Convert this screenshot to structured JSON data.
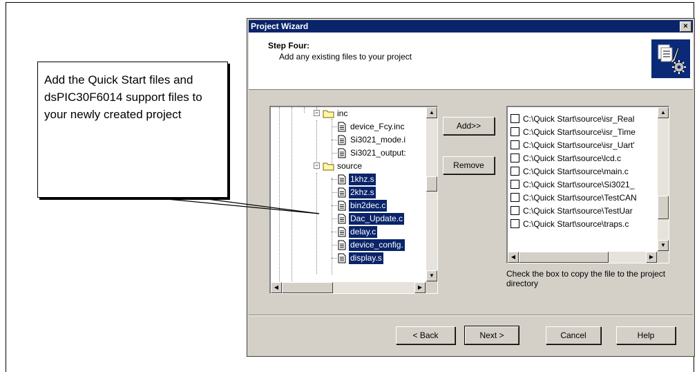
{
  "callout": {
    "text": "Add the Quick Start files and dsPIC30F6014 support files to your newly created project"
  },
  "dialog": {
    "title": "Project Wizard",
    "close_glyph": "×",
    "step_title": "Step Four:",
    "step_subtitle": "Add any existing files to your project",
    "header_icon": "wizard-tools-icon"
  },
  "tree": {
    "items": [
      {
        "label": "inc",
        "type": "folder",
        "expanded": true,
        "selected": false
      },
      {
        "label": "device_Fcy.inc",
        "type": "file",
        "selected": false
      },
      {
        "label": "Si3021_mode.i",
        "type": "file",
        "selected": false
      },
      {
        "label": "Si3021_output:",
        "type": "file",
        "selected": false
      },
      {
        "label": "source",
        "type": "folder",
        "expanded": true,
        "selected": false
      },
      {
        "label": "1khz.s",
        "type": "file",
        "selected": true
      },
      {
        "label": "2khz.s",
        "type": "file",
        "selected": true
      },
      {
        "label": "bin2dec.c",
        "type": "file",
        "selected": true
      },
      {
        "label": "Dac_Update.c",
        "type": "file",
        "selected": true
      },
      {
        "label": "delay.c",
        "type": "file",
        "selected": true
      },
      {
        "label": "device_config.",
        "type": "file",
        "selected": true
      },
      {
        "label": "display.s",
        "type": "file",
        "selected": true
      }
    ]
  },
  "buttons": {
    "add": "Add>>",
    "remove": "Remove",
    "back": "< Back",
    "next": "Next >",
    "cancel": "Cancel",
    "help": "Help"
  },
  "file_list": {
    "items": [
      {
        "path": "C:\\Quick Start\\source\\isr_Real",
        "checked": false
      },
      {
        "path": "C:\\Quick Start\\source\\isr_Time",
        "checked": false
      },
      {
        "path": "C:\\Quick Start\\source\\isr_Uart'",
        "checked": false
      },
      {
        "path": "C:\\Quick Start\\source\\lcd.c",
        "checked": false
      },
      {
        "path": "C:\\Quick Start\\source\\main.c",
        "checked": false
      },
      {
        "path": "C:\\Quick Start\\source\\Si3021_",
        "checked": false
      },
      {
        "path": "C:\\Quick Start\\source\\TestCAN",
        "checked": false
      },
      {
        "path": "C:\\Quick Start\\source\\TestUar",
        "checked": false
      },
      {
        "path": "C:\\Quick Start\\source\\traps.c",
        "checked": false
      }
    ],
    "hint": "Check the box to copy the file to the project directory"
  },
  "colors": {
    "selection": "#0a246a",
    "titlebar": "#0a246a",
    "dialog_face": "#d4d0c8"
  }
}
